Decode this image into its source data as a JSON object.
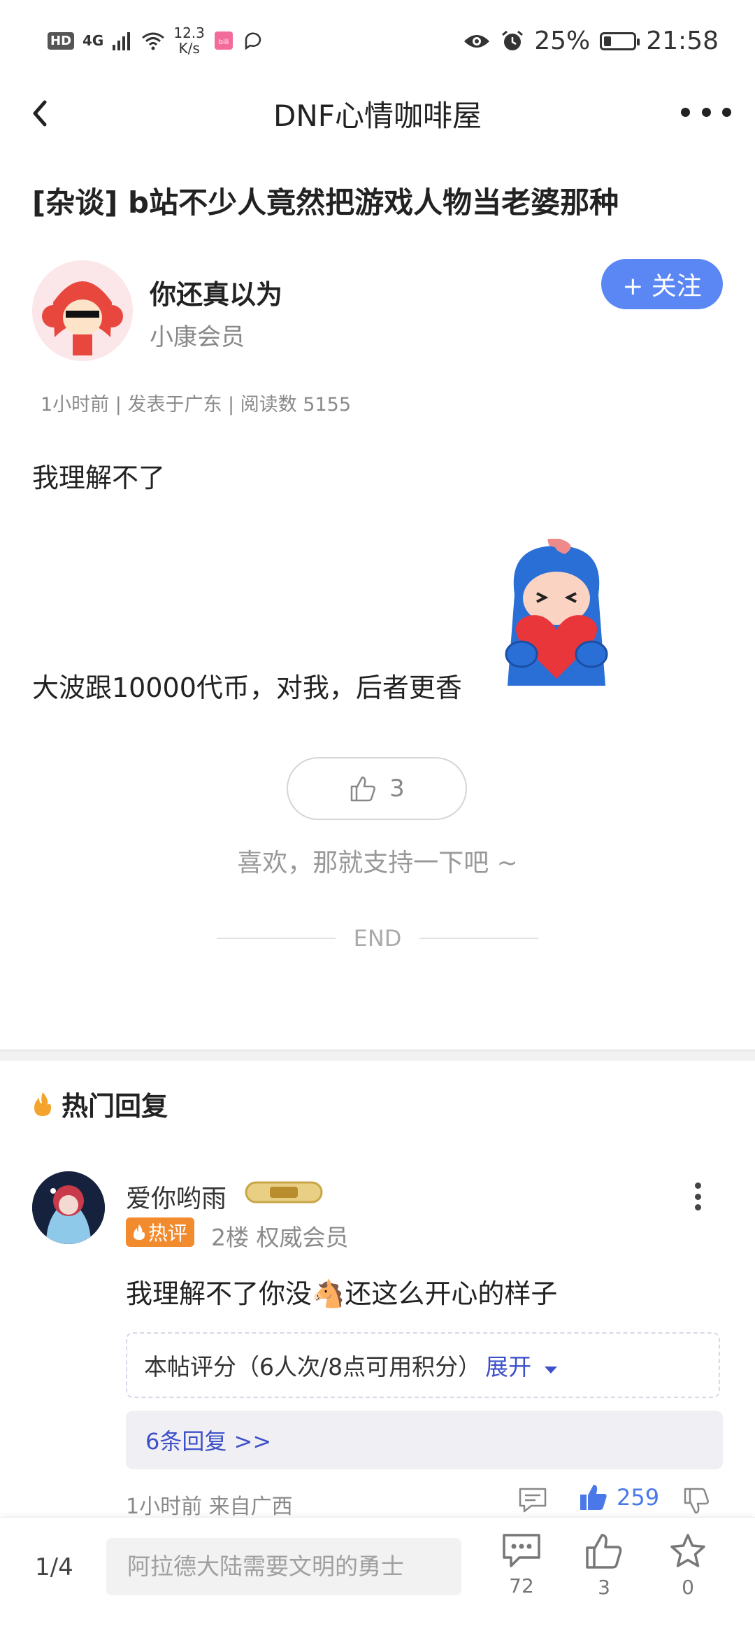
{
  "status_bar": {
    "hd": "HD",
    "network": "4G",
    "speed_value": "12.3",
    "speed_unit": "K/s",
    "battery_text": "25%",
    "battery_level": 0.25,
    "time": "21:58"
  },
  "nav": {
    "title": "DNF心情咖啡屋"
  },
  "post": {
    "title": "[杂谈] b站不少人竟然把游戏人物当老婆那种",
    "author_name": "你还真以为",
    "author_level": "小康会员",
    "follow_label": "+ 关注",
    "meta": "1小时前 | 发表于广东 | 阅读数 5155",
    "paragraph_1": "我理解不了",
    "paragraph_2": "大波跟10000代币，对我，后者更香",
    "like_count": "3",
    "support_text": "喜欢，那就支持一下吧 ~",
    "end_text": "END"
  },
  "hot_replies": {
    "header": "热门回复",
    "comment": {
      "user_name": "爱你哟雨",
      "hot_tag": "热评",
      "floor_info": "2楼 权威会员",
      "text": "我理解不了你没🐴还这么开心的样子",
      "rating_text": "本帖评分（6人次/8点可用积分）",
      "rating_expand": "展开",
      "replies_link": "6条回复 >>",
      "time_location": "1小时前 来自广西",
      "like_count": "259"
    }
  },
  "bottom_bar": {
    "page_indicator": "1/4",
    "input_placeholder": "阿拉德大陆需要文明的勇士",
    "comments_count": "72",
    "likes_count": "3",
    "favorites_count": "0"
  },
  "colors": {
    "accent_blue": "#5b87f5",
    "link_blue": "#3e50c7",
    "hot_orange": "#f28a2e"
  }
}
